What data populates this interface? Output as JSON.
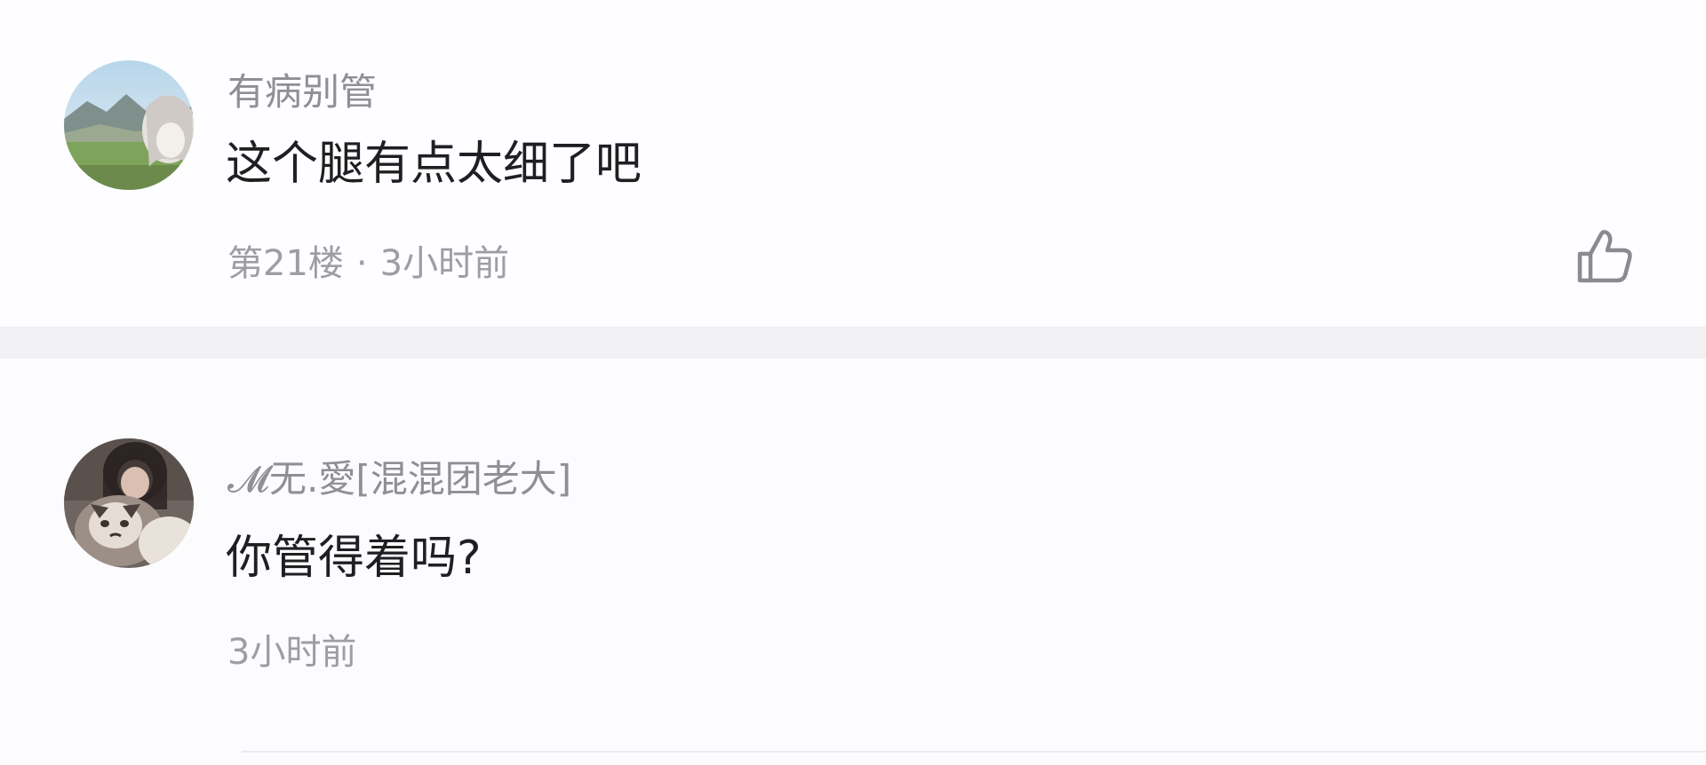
{
  "comments": [
    {
      "username": "有病别管",
      "content": "这个腿有点太细了吧",
      "floor": "第21楼",
      "time": "3小时前",
      "avatar_icon": "landscape-anime-avatar-icon"
    },
    {
      "username": "𝓜无.愛[混混团老大]",
      "content": "你管得着吗?",
      "time": "3小时前",
      "avatar_icon": "girl-with-cat-avatar-icon"
    }
  ],
  "icons": {
    "like": "thumbs-up-icon"
  },
  "colors": {
    "background": "#fcfbfd",
    "divider": "#f2f1f4",
    "username": "#8f8f94",
    "content": "#1f1f22",
    "meta": "#9d9da3",
    "icon": "#8a8a90"
  }
}
